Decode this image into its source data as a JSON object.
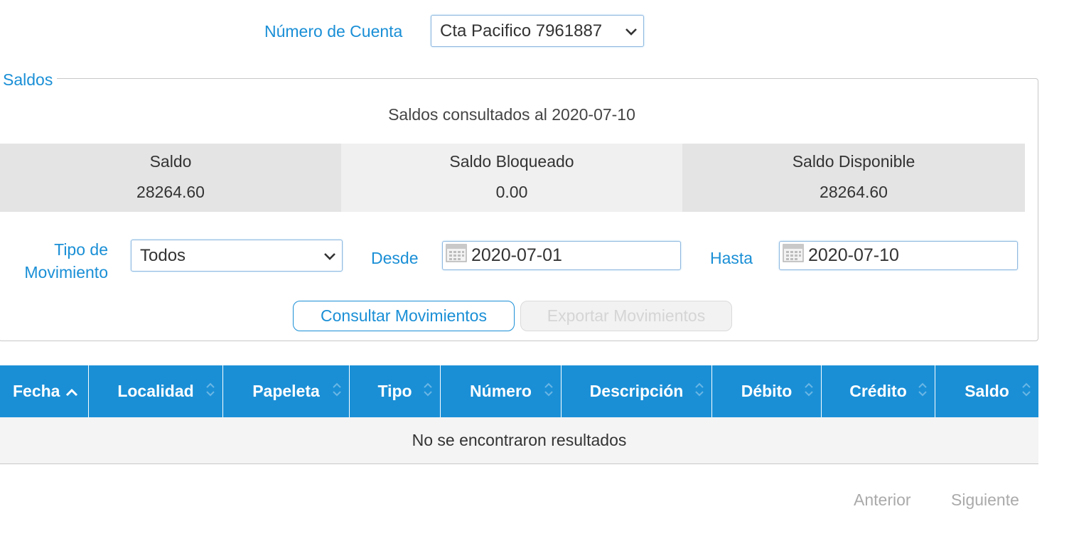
{
  "colors": {
    "accent": "#1a8fd6",
    "header_bg": "#1a8fd6",
    "balance_bg": "#e4e4e4",
    "disabled_text": "#d5d5d5"
  },
  "account": {
    "label": "Número de Cuenta",
    "selected": "Cta Pacifico 7961887",
    "icon": "chevron-down-icon"
  },
  "balances": {
    "legend": "Saldos",
    "consulted_text": "Saldos consultados al 2020-07-10",
    "items": [
      {
        "label": "Saldo",
        "value": "28264.60"
      },
      {
        "label": "Saldo Bloqueado",
        "value": "0.00"
      },
      {
        "label": "Saldo Disponible",
        "value": "28264.60"
      }
    ]
  },
  "filters": {
    "tipo_label": "Tipo de Movimiento",
    "tipo_value": "Todos",
    "desde_label": "Desde",
    "desde_value": "2020-07-01",
    "hasta_label": "Hasta",
    "hasta_value": "2020-07-10",
    "date_icon": "calendar-icon"
  },
  "buttons": {
    "consultar": "Consultar Movimientos",
    "exportar": "Exportar Movimientos"
  },
  "table": {
    "columns": [
      "Fecha",
      "Localidad",
      "Papeleta",
      "Tipo",
      "Número",
      "Descripción",
      "Débito",
      "Crédito",
      "Saldo"
    ],
    "sorted_column": "Fecha",
    "sort_direction": "ascending",
    "empty_message": "No se encontraron resultados"
  },
  "pagination": {
    "prev": "Anterior",
    "next": "Siguiente"
  }
}
